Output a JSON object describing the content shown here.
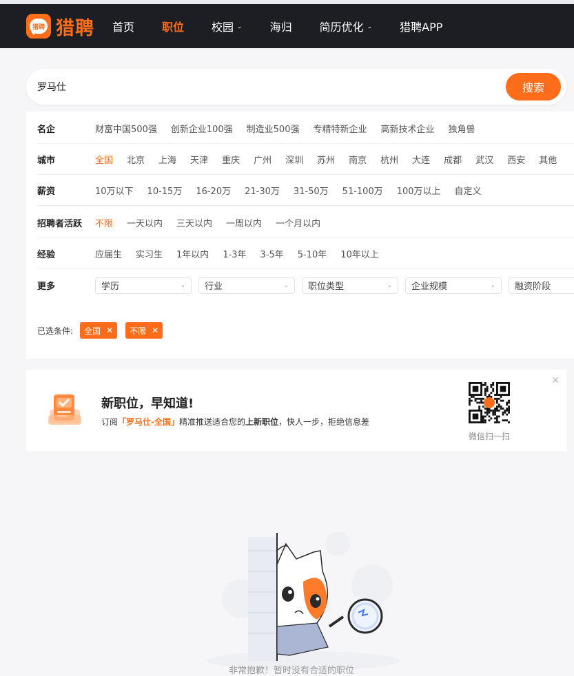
{
  "nav": {
    "logo_text": "猎聘",
    "logo_badge": "猎聘",
    "items": [
      {
        "label": "首页",
        "active": false,
        "dropdown": false
      },
      {
        "label": "职位",
        "active": true,
        "dropdown": false
      },
      {
        "label": "校园",
        "active": false,
        "dropdown": true
      },
      {
        "label": "海归",
        "active": false,
        "dropdown": false
      },
      {
        "label": "简历优化",
        "active": false,
        "dropdown": true
      },
      {
        "label": "猎聘APP",
        "active": false,
        "dropdown": false
      }
    ]
  },
  "search": {
    "value": "罗马仕",
    "button_label": "搜索"
  },
  "filters": {
    "famous": {
      "label": "名企",
      "options": [
        "财富中国500强",
        "创新企业100强",
        "制造业500强",
        "专精特新企业",
        "高新技术企业",
        "独角兽"
      ],
      "active": -1
    },
    "city": {
      "label": "城市",
      "options": [
        "全国",
        "北京",
        "上海",
        "天津",
        "重庆",
        "广州",
        "深圳",
        "苏州",
        "南京",
        "杭州",
        "大连",
        "成都",
        "武汉",
        "西安",
        "其他"
      ],
      "active": 0
    },
    "salary": {
      "label": "薪资",
      "options": [
        "10万以下",
        "10-15万",
        "16-20万",
        "21-30万",
        "31-50万",
        "51-100万",
        "100万以上",
        "自定义"
      ],
      "active": -1
    },
    "activity": {
      "label": "招聘者活跃",
      "options": [
        "不限",
        "一天以内",
        "三天以内",
        "一周以内",
        "一个月以内"
      ],
      "active": 0
    },
    "experience": {
      "label": "经验",
      "options": [
        "应届生",
        "实习生",
        "1年以内",
        "1-3年",
        "3-5年",
        "5-10年",
        "10年以上"
      ],
      "active": -1
    },
    "more": {
      "label": "更多",
      "dropdowns": [
        "学历",
        "行业",
        "职位类型",
        "企业规模",
        "融资阶段"
      ]
    }
  },
  "selected": {
    "label": "已选条件:",
    "tags": [
      "全国",
      "不限"
    ]
  },
  "subscribe": {
    "title": "新职位，早知道!",
    "desc_prefix": "订阅",
    "desc_highlight": "「罗马仕-全国」",
    "desc_mid": "精准推送适合您的",
    "desc_bold": "上新职位",
    "desc_suffix": "，快人一步，拒绝信息差",
    "qr_label": "微信扫一扫"
  },
  "empty": {
    "text": "非常抱歉！暂时没有合适的职位"
  },
  "colors": {
    "accent": "#ff6d1a",
    "nav_bg": "#1d1e23",
    "page_bg": "#f6f6f8"
  }
}
